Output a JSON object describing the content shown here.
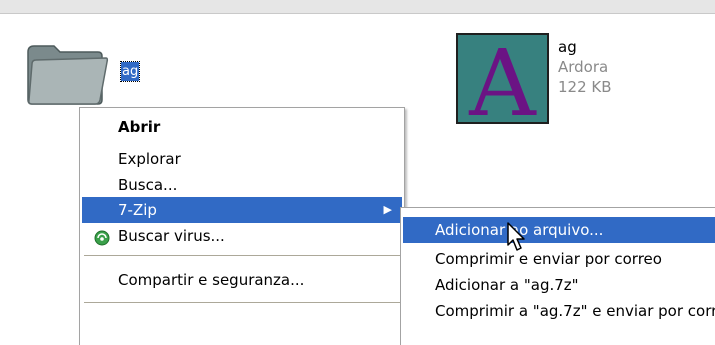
{
  "desktop": {
    "folder": {
      "label": "ag",
      "icon": "folder-icon"
    },
    "file": {
      "name": "ag",
      "type": "Ardora",
      "size": "122 KB",
      "thumbnail_letter": "A",
      "icon": "ardora-file-icon"
    }
  },
  "context_menu": {
    "items": [
      {
        "label": "Abrir",
        "bold": true
      },
      {
        "label": "Explorar"
      },
      {
        "label": "Busca..."
      },
      {
        "label": "7-Zip",
        "selected": true,
        "has_submenu": true
      },
      {
        "label": "Buscar virus...",
        "icon": "virus-scan-icon"
      },
      {
        "label": "Compartir e seguranza..."
      }
    ]
  },
  "submenu_7zip": {
    "items": [
      {
        "label": "Adicionar ao arquivo...",
        "selected": true
      },
      {
        "label": "Comprimir e enviar por correo"
      },
      {
        "label": "Adicionar a \"ag.7z\""
      },
      {
        "label": "Comprimir a \"ag.7z\" e enviar por correo"
      }
    ]
  },
  "colors": {
    "selection": "#316ac5",
    "thumbnail_bg": "#37817f",
    "thumbnail_letter": "#6b1384"
  }
}
